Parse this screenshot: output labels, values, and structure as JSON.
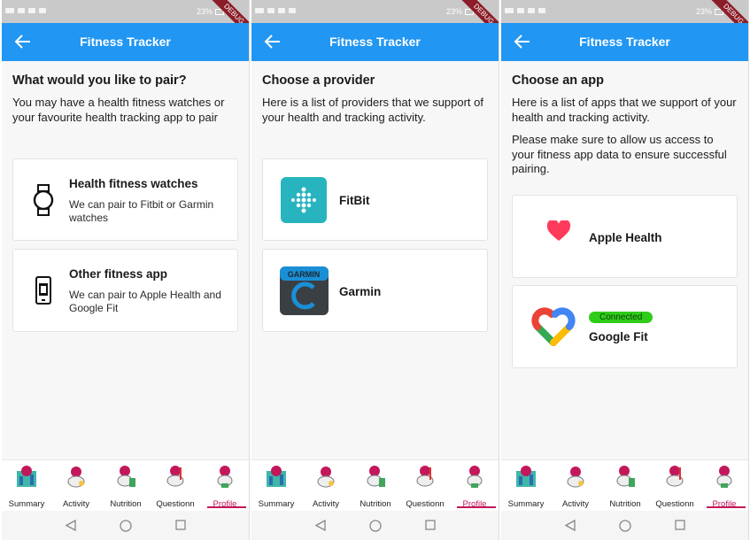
{
  "status_bar": {
    "battery": "23%"
  },
  "debug_banner": "DEBUG",
  "app_title": "Fitness Tracker",
  "screens": [
    {
      "heading": "What would you like to pair?",
      "description": "You may have a health fitness watches or your favourite health tracking app to pair",
      "cards": [
        {
          "title": "Health fitness watches",
          "subtitle": "We can pair to Fitbit or Garmin watches",
          "icon": "watch-icon"
        },
        {
          "title": "Other fitness app",
          "subtitle": "We can pair to Apple Health and Google Fit",
          "icon": "phone-app-icon"
        }
      ]
    },
    {
      "heading": "Choose a provider",
      "description": "Here is a list of providers that we support of your health and tracking activity.",
      "cards": [
        {
          "title": "FitBit",
          "icon": "fitbit-logo",
          "accent": "#27b4bf"
        },
        {
          "title": "Garmin",
          "icon": "garmin-logo",
          "accent": "#1a8fd6",
          "logo_text": "GARMIN"
        }
      ]
    },
    {
      "heading": "Choose an app",
      "description": "Here is a list of apps that we support of your health and tracking activity.",
      "description2": "Please make sure to allow us access to your fitness app data to ensure successful pairing.",
      "cards": [
        {
          "title": "Apple Health",
          "icon": "heart-icon",
          "accent": "#ff3b5c"
        },
        {
          "title": "Google Fit",
          "icon": "google-fit-logo",
          "badge": "Connected",
          "badge_color": "#2ecc17"
        }
      ]
    }
  ],
  "bottom_nav": {
    "items": [
      "Summary",
      "Activity",
      "Nutrition",
      "Questionn",
      "Profile"
    ],
    "active": "Profile",
    "active_color": "#c2185b"
  },
  "colors": {
    "appbar": "#2196f3",
    "background": "#f7f7f7"
  }
}
